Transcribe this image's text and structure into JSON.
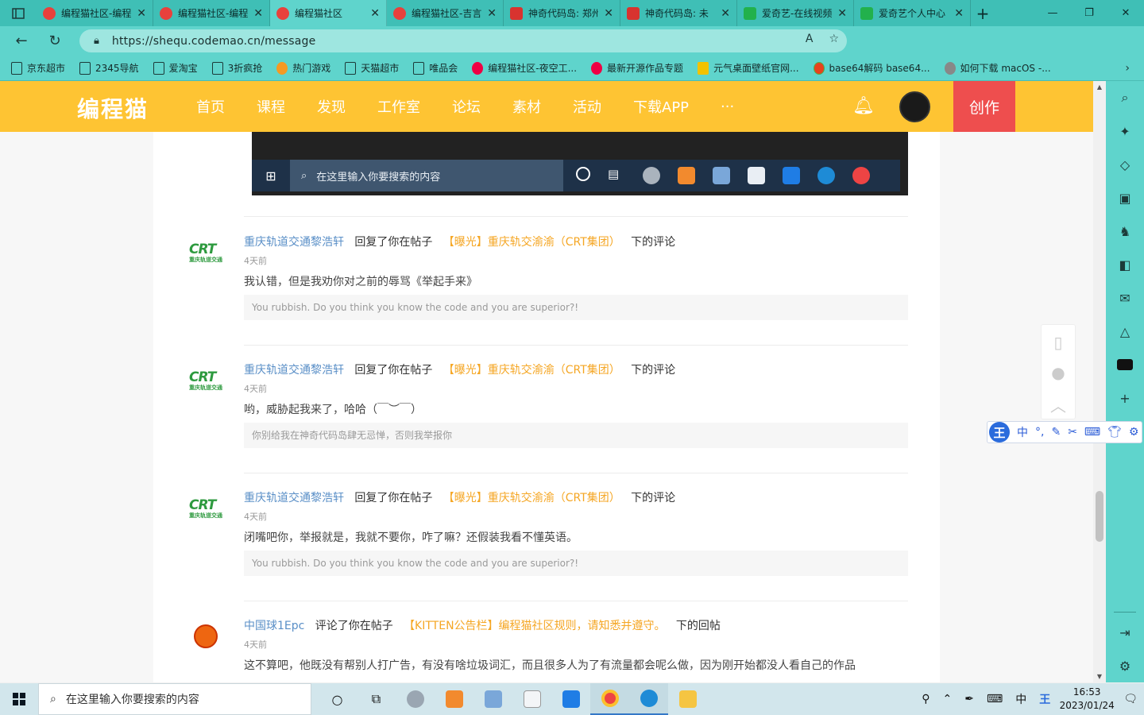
{
  "browser": {
    "tabs": [
      {
        "label": "编程猫社区-编程",
        "active": false
      },
      {
        "label": "编程猫社区-编程",
        "active": false
      },
      {
        "label": "编程猫社区",
        "active": true
      },
      {
        "label": "编程猫社区-吉言",
        "active": false
      },
      {
        "label": "神奇代码岛: 郑州",
        "active": false
      },
      {
        "label": "神奇代码岛: 未",
        "active": false
      },
      {
        "label": "爱奇艺-在线视频",
        "active": false
      },
      {
        "label": "爱奇艺个人中心",
        "active": false
      }
    ],
    "url": "https://shequ.codemao.cn/message",
    "bookmarks": [
      "京东超市",
      "2345导航",
      "爱淘宝",
      "3折疯抢",
      "热门游戏",
      "天猫超市",
      "唯品会",
      "编程猫社区-夜空工...",
      "最新开源作品专题",
      "元气桌面壁纸官网...",
      "base64解码 base64...",
      "如何下载 macOS -..."
    ]
  },
  "site": {
    "logo": "编程猫",
    "nav": [
      "首页",
      "课程",
      "发现",
      "工作室",
      "论坛",
      "素材",
      "活动",
      "下载APP",
      "···"
    ],
    "create_label": "创作"
  },
  "embedded_image": {
    "search_placeholder": "在这里输入你要搜索的内容"
  },
  "messages": [
    {
      "user": "重庆轨道交通黎浩轩",
      "action_prefix": "回复了你在帖子",
      "post": "【曝光】重庆轨交渝渝（CRT集团）",
      "action_suffix": "下的评论",
      "time": "4天前",
      "body": "我认错，但是我劝你对之前的辱骂《举起手来》",
      "quote": "You rubbish. Do you think you know the code and you are superior?!"
    },
    {
      "user": "重庆轨道交通黎浩轩",
      "action_prefix": "回复了你在帖子",
      "post": "【曝光】重庆轨交渝渝（CRT集团）",
      "action_suffix": "下的评论",
      "time": "4天前",
      "body": "哟，威胁起我来了，哈哈（￣︶￣）",
      "quote": "你别给我在神奇代码岛肆无忌惮，否则我举报你"
    },
    {
      "user": "重庆轨道交通黎浩轩",
      "action_prefix": "回复了你在帖子",
      "post": "【曝光】重庆轨交渝渝（CRT集团）",
      "action_suffix": "下的评论",
      "time": "4天前",
      "body": "闭嘴吧你，举报就是，我就不要你，咋了嘛？还假装我看不懂英语。",
      "quote": "You rubbish. Do you think you know the code and you are superior?!"
    },
    {
      "user": "中国球1Epc",
      "action_prefix": "评论了你在帖子",
      "post": "【KITTEN公告栏】编程猫社区规则，请知悉并遵守。",
      "action_suffix": "下的回帖",
      "time": "4天前",
      "body": "这不算吧，他既没有帮别人打广告，有没有啥垃圾词汇，而且很多人为了有流量都会呢么做，因为刚开始都没人看自己的作品",
      "quote": ""
    }
  ],
  "crt_logo_text": "重庆轨道交通",
  "taskbar": {
    "search_placeholder": "在这里输入你要搜索的内容",
    "ime": "中",
    "time": "16:53",
    "date": "2023/01/24"
  }
}
